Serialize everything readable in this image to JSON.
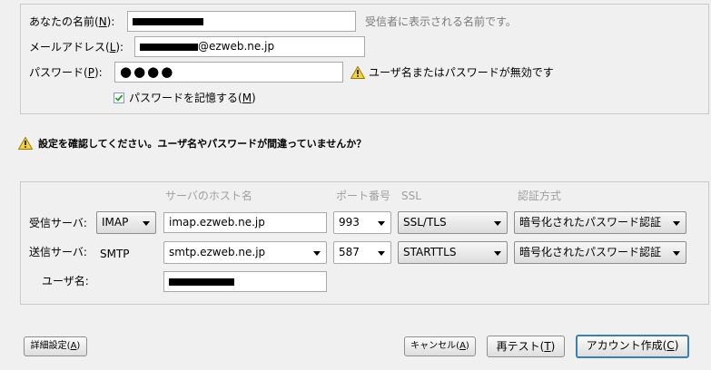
{
  "account": {
    "name_label": "あなたの名前(",
    "name_key": "N",
    "name_label_end": "):",
    "name_hint": "受信者に表示される名前です。",
    "email_label": "メールアドレス(",
    "email_key": "L",
    "email_label_end": "):",
    "email_domain": "@ezweb.ne.jp",
    "password_label": "パスワード(",
    "password_key": "P",
    "password_label_end": "):",
    "password_value": "●●●●",
    "password_warning": "ユーザ名またはパスワードが無効です",
    "remember_label": "パスワードを記憶する(",
    "remember_key": "M",
    "remember_label_end": ")",
    "remember_checked": true
  },
  "notice": {
    "text": "設定を確認してください。ユーザ名やパスワードが間違っていませんか？"
  },
  "server_config": {
    "headers": {
      "host": "サーバのホスト名",
      "port": "ポート番号",
      "ssl": "SSL",
      "auth": "認証方式"
    },
    "incoming": {
      "label": "受信サーバ:",
      "protocol": "IMAP",
      "host": "imap.ezweb.ne.jp",
      "port": "993",
      "ssl": "SSL/TLS",
      "auth": "暗号化されたパスワード認証"
    },
    "outgoing": {
      "label": "送信サーバ:",
      "protocol": "SMTP",
      "host": "smtp.ezweb.ne.jp",
      "port": "587",
      "ssl": "STARTTLS",
      "auth": "暗号化されたパスワード認証"
    },
    "username_label": "ユーザ名:"
  },
  "buttons": {
    "advanced": "詳細設定(",
    "advanced_key": "A",
    "advanced_end": ")",
    "cancel": "キャンセル(",
    "cancel_key": "A",
    "cancel_end": ")",
    "retest": "再テスト(",
    "retest_key": "T",
    "retest_end": ")",
    "create": "アカウント作成(",
    "create_key": "C",
    "create_end": ")"
  },
  "colors": {
    "warning_yellow": "#f5d43b",
    "default_button_border": "#3c7fb1"
  }
}
